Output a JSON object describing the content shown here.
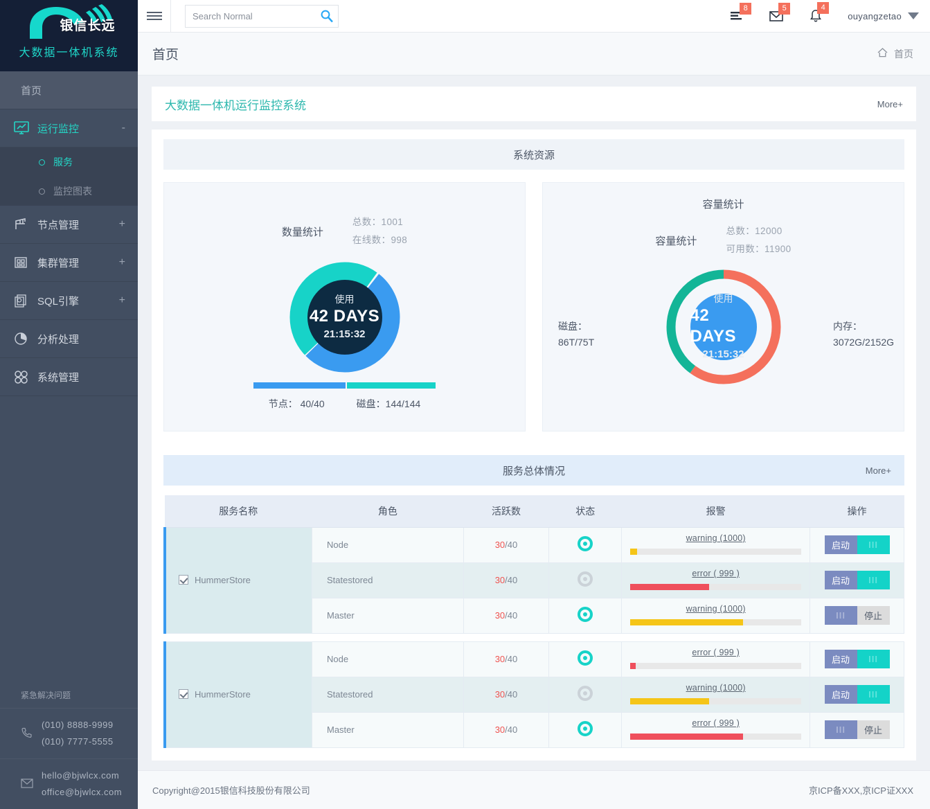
{
  "sidebar": {
    "logo_text": "银信长远",
    "logo_sub": "大数据一体机系统",
    "home_label": "首页",
    "items": [
      {
        "label": "运行监控",
        "icon": "monitor-icon",
        "toggle": "-",
        "active": true
      },
      {
        "label": "节点管理",
        "icon": "node-icon",
        "toggle": "+",
        "active": false
      },
      {
        "label": "集群管理",
        "icon": "cluster-icon",
        "toggle": "+",
        "active": false
      },
      {
        "label": "SQL引擎",
        "icon": "sql-icon",
        "toggle": "+",
        "active": false
      },
      {
        "label": "分析处理",
        "icon": "pie-icon",
        "toggle": "",
        "active": false
      },
      {
        "label": "系统管理",
        "icon": "grid-icon",
        "toggle": "",
        "active": false
      }
    ],
    "sub_items": [
      {
        "label": "服务",
        "selected": true
      },
      {
        "label": "监控图表",
        "selected": false
      }
    ],
    "contact_title": "紧急解决问题",
    "phone_1": "(010) 8888-9999",
    "phone_2": "(010) 7777-5555",
    "email_1": "hello@bjwlcx.com",
    "email_2": "office@bjwlcx.com"
  },
  "topbar": {
    "search_placeholder": "Search Normal",
    "search_value": "",
    "tasks_badge": "8",
    "mail_badge": "5",
    "bell_badge": "4",
    "username": "ouyangzetao"
  },
  "breadcrumb": {
    "title": "首页",
    "home_label": "首页"
  },
  "panel": {
    "title": "大数据一体机运行监控系统",
    "more": "More+"
  },
  "system_resource": {
    "heading": "系统资源",
    "left": {
      "stat_label": "数量统计",
      "total_label": "总数：1001",
      "online_label": "在线数：998",
      "center_use": "使用",
      "center_days": "42 DAYS",
      "center_time": "21:15:32",
      "bar_label_1": "节点： 40/40",
      "bar_label_2": "磁盘：144/144"
    },
    "right": {
      "card_title": "容量统计",
      "stat_label": "容量统计",
      "total_label": "总数：12000",
      "available_label": "可用数：11900",
      "center_use": "使用",
      "center_days": "42 DAYS",
      "center_time": "21:15:32",
      "disk_label": "磁盘：",
      "disk_value": "86T/75T",
      "mem_label": "内存：",
      "mem_value": "3072G/2152G"
    }
  },
  "chart_data": [
    {
      "type": "pie",
      "title": "数量统计",
      "legend_position": "inside-center",
      "labels": [
        "节点",
        "磁盘"
      ],
      "values": [
        40,
        144
      ],
      "slice_fractions": [
        0.52,
        0.48
      ],
      "colors": [
        "#3a9bf0",
        "#17d3c8"
      ],
      "annotations": [
        "使用",
        "42 DAYS",
        "21:15:32",
        "总数：1001",
        "在线数：998"
      ]
    },
    {
      "type": "pie",
      "title": "容量统计",
      "legend_position": "outside-sides",
      "labels": [
        "磁盘",
        "内存"
      ],
      "values": [
        86,
        3072
      ],
      "slice_fractions": [
        0.4,
        0.6
      ],
      "colors": [
        "#13b597",
        "#f4705c"
      ],
      "annotations": [
        "使用",
        "42 DAYS",
        "21:15:32",
        "总数：12000",
        "可用数：11900",
        "磁盘：86T/75T",
        "内存：3072G/2152G"
      ]
    }
  ],
  "services": {
    "heading": "服务总体情况",
    "more": "More+",
    "columns": [
      "服务名称",
      "角色",
      "活跃数",
      "状态",
      "报警",
      "操作"
    ],
    "groups": [
      {
        "name": "HummerStore",
        "checked": true,
        "rows": [
          {
            "role": "Node",
            "active_num": "30",
            "active_total": "/40",
            "status": "on",
            "alarm": "warning (1000)",
            "alarm_pct": 4,
            "alarm_color": "#f5c518",
            "btn_left": "启动",
            "btn_right": "III",
            "btn_style": "start"
          },
          {
            "role": "Statestored",
            "active_num": "30",
            "active_total": "/40",
            "status": "off",
            "alarm": "error ( 999 )",
            "alarm_pct": 46,
            "alarm_color": "#ef4f5c",
            "btn_left": "启动",
            "btn_right": "III",
            "btn_style": "start"
          },
          {
            "role": "Master",
            "active_num": "30",
            "active_total": "/40",
            "status": "on",
            "alarm": "warning (1000)",
            "alarm_pct": 66,
            "alarm_color": "#f5c518",
            "btn_left": "III",
            "btn_right": "停止",
            "btn_style": "stop"
          }
        ]
      },
      {
        "name": "HummerStore",
        "checked": true,
        "rows": [
          {
            "role": "Node",
            "active_num": "30",
            "active_total": "/40",
            "status": "on",
            "alarm": "error ( 999 )",
            "alarm_pct": 3,
            "alarm_color": "#ef4f5c",
            "btn_left": "启动",
            "btn_right": "III",
            "btn_style": "start"
          },
          {
            "role": "Statestored",
            "active_num": "30",
            "active_total": "/40",
            "status": "off",
            "alarm": "warning (1000)",
            "alarm_pct": 46,
            "alarm_color": "#f5c518",
            "btn_left": "启动",
            "btn_right": "III",
            "btn_style": "start"
          },
          {
            "role": "Master",
            "active_num": "30",
            "active_total": "/40",
            "status": "on",
            "alarm": "error ( 999 )",
            "alarm_pct": 66,
            "alarm_color": "#ef4f5c",
            "btn_left": "III",
            "btn_right": "停止",
            "btn_style": "stop"
          }
        ]
      }
    ]
  },
  "footer": {
    "copyright": "Copyright@2015银信科技股份有限公司",
    "icp": "京ICP备XXX,京ICP证XXX"
  },
  "colors": {
    "accent_teal": "#24d6c6",
    "accent_blue": "#3a9bf0",
    "badge_red": "#f4705c",
    "panel_title": "#2eb8ae"
  }
}
